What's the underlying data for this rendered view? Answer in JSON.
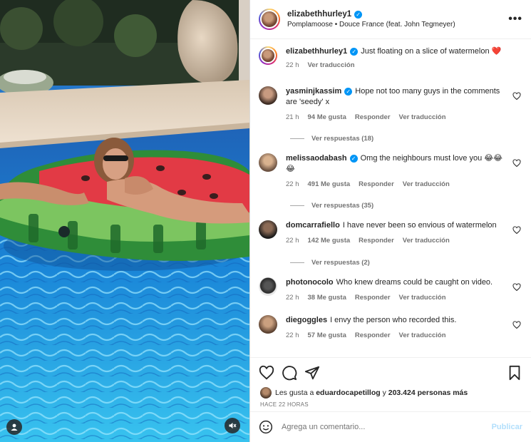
{
  "header": {
    "username": "elizabethhurley1",
    "song": "Pomplamoose • Douce France (feat. John Tegmeyer)",
    "more_label": "•••"
  },
  "caption": {
    "username": "elizabethhurley1",
    "text": "Just floating on a slice of watermelon ❤️",
    "time": "22 h",
    "translate": "Ver traducción"
  },
  "comments": [
    {
      "username": "yasminjkassim",
      "verified": true,
      "text": "Hope not too many guys in the comments are 'seedy' x",
      "time": "21 h",
      "likes": "94 Me gusta",
      "reply": "Responder",
      "translate": "Ver traducción",
      "replies": "Ver respuestas (18)"
    },
    {
      "username": "melissaodabash",
      "verified": true,
      "text": "Omg the neighbours must love you 😂😂😂",
      "time": "22 h",
      "likes": "491 Me gusta",
      "reply": "Responder",
      "translate": "Ver traducción",
      "replies": "Ver respuestas (35)"
    },
    {
      "username": "domcarrafiello",
      "verified": false,
      "text": "I have never been so envious of watermelon",
      "time": "22 h",
      "likes": "142 Me gusta",
      "reply": "Responder",
      "translate": "Ver traducción",
      "replies": "Ver respuestas (2)"
    },
    {
      "username": "photonocolo",
      "verified": false,
      "text": "Who knew dreams could be caught on video.",
      "time": "22 h",
      "likes": "38 Me gusta",
      "reply": "Responder",
      "translate": "Ver traducción",
      "replies": ""
    },
    {
      "username": "diegoggles",
      "verified": false,
      "text": "I envy the person who recorded this.",
      "time": "22 h",
      "likes": "57 Me gusta",
      "reply": "Responder",
      "translate": "Ver traducción",
      "replies": ""
    }
  ],
  "likes_summary": {
    "prefix": "Les gusta a",
    "user": "eduardocapetillog",
    "conjunction": "y",
    "count": "203.424 personas más"
  },
  "timestamp": "HACE 22 HORAS",
  "add_comment": {
    "placeholder": "Agrega un comentario...",
    "post_label": "Publicar"
  },
  "icons": {
    "more": "more-icon",
    "like": "heart-icon",
    "comment": "comment-icon",
    "share": "share-icon",
    "save": "bookmark-icon",
    "emoji": "emoji-icon",
    "user_tag": "user-tag-icon",
    "mute": "mute-icon"
  },
  "colors": {
    "verified": "#0095f6",
    "text": "#262626",
    "muted": "#737373",
    "post_disabled": "#b2dffc",
    "heart_red": "#ed4956"
  }
}
